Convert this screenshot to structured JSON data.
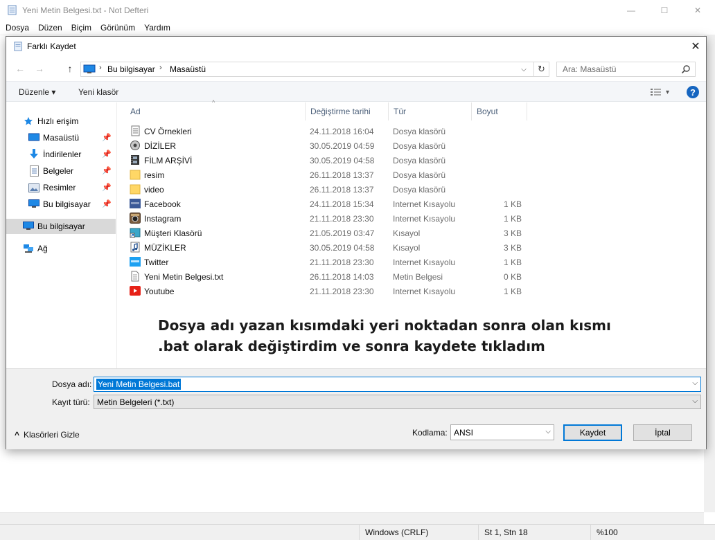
{
  "notepad": {
    "title": "Yeni Metin Belgesi.txt - Not Defteri",
    "menu": [
      "Dosya",
      "Düzen",
      "Biçim",
      "Görünüm",
      "Yardım"
    ],
    "status": {
      "line_ending": "Windows (CRLF)",
      "position": "St 1, Stn 18",
      "zoom": "%100"
    },
    "controls": {
      "minimize": "—",
      "maximize": "☐",
      "close": "✕"
    }
  },
  "dialog": {
    "title": "Farklı Kaydet",
    "close": "✕",
    "nav": {
      "back": "←",
      "forward": "→",
      "up": "↑"
    },
    "address": {
      "segments": [
        "Bu bilgisayar",
        "Masaüstü"
      ],
      "separator": "›",
      "dropdown": "⌵",
      "refresh": "↻"
    },
    "search": {
      "placeholder": "Ara: Masaüstü"
    },
    "commands": {
      "organize": "Düzenle ▾",
      "new_folder": "Yeni klasör",
      "help": "?",
      "view": "▾"
    },
    "sidebar": {
      "items": [
        {
          "label": "Hızlı erişim",
          "icon": "star-icon",
          "pinned": false
        },
        {
          "label": "Masaüstü",
          "icon": "desktop-icon",
          "pinned": true
        },
        {
          "label": "İndirilenler",
          "icon": "download-icon",
          "pinned": true
        },
        {
          "label": "Belgeler",
          "icon": "documents-icon",
          "pinned": true
        },
        {
          "label": "Resimler",
          "icon": "pictures-icon",
          "pinned": true
        },
        {
          "label": "Bu bilgisayar",
          "icon": "computer-icon",
          "pinned": true
        },
        {
          "label": "Bu bilgisayar",
          "icon": "computer-icon",
          "pinned": false,
          "selected": true
        },
        {
          "label": "Ağ",
          "icon": "network-icon",
          "pinned": false
        }
      ],
      "pin_glyph": "📌"
    },
    "columns": [
      "Ad",
      "Değiştirme tarihi",
      "Tür",
      "Boyut"
    ],
    "sort_glyph": "^",
    "files": [
      {
        "name": "CV Örnekleri",
        "date": "24.11.2018 16:04",
        "type": "Dosya klasörü",
        "size": "",
        "icon": "folder-docs-icon"
      },
      {
        "name": "DİZİLER",
        "date": "30.05.2019 04:59",
        "type": "Dosya klasörü",
        "size": "",
        "icon": "folder-media-icon"
      },
      {
        "name": "FİLM ARŞİVİ",
        "date": "30.05.2019 04:58",
        "type": "Dosya klasörü",
        "size": "",
        "icon": "folder-film-icon"
      },
      {
        "name": "resim",
        "date": "26.11.2018 13:37",
        "type": "Dosya klasörü",
        "size": "",
        "icon": "folder-icon"
      },
      {
        "name": "video",
        "date": "26.11.2018 13:37",
        "type": "Dosya klasörü",
        "size": "",
        "icon": "folder-icon"
      },
      {
        "name": "Facebook",
        "date": "24.11.2018 15:34",
        "type": "Internet Kısayolu",
        "size": "1 KB",
        "icon": "facebook-icon"
      },
      {
        "name": "Instagram",
        "date": "21.11.2018 23:30",
        "type": "Internet Kısayolu",
        "size": "1 KB",
        "icon": "instagram-icon"
      },
      {
        "name": "Müşteri Klasörü",
        "date": "21.05.2019 03:47",
        "type": "Kısayol",
        "size": "3 KB",
        "icon": "shortcut-icon"
      },
      {
        "name": "MÜZİKLER",
        "date": "30.05.2019 04:58",
        "type": "Kısayol",
        "size": "3 KB",
        "icon": "music-icon"
      },
      {
        "name": "Twitter",
        "date": "21.11.2018 23:30",
        "type": "Internet Kısayolu",
        "size": "1 KB",
        "icon": "twitter-icon"
      },
      {
        "name": "Yeni Metin Belgesi.txt",
        "date": "26.11.2018 14:03",
        "type": "Metin Belgesi",
        "size": "0 KB",
        "icon": "text-file-icon"
      },
      {
        "name": "Youtube",
        "date": "21.11.2018 23:30",
        "type": "Internet Kısayolu",
        "size": "1 KB",
        "icon": "youtube-icon"
      }
    ],
    "annotation": "Dosya adı yazan kısımdaki yeri noktadan sonra olan kısmı .bat olarak değiştirdim ve sonra kaydete tıkladım",
    "form": {
      "filename_label": "Dosya adı:",
      "filename_value": "Yeni Metin Belgesi.bat",
      "filetype_label": "Kayıt türü:",
      "filetype_value": "Metin Belgeleri (*.txt)",
      "encoding_label": "Kodlama:",
      "encoding_value": "ANSI",
      "save": "Kaydet",
      "cancel": "İptal",
      "hide_folders": "Klasörleri Gizle",
      "hide_glyph": "^",
      "dropdown_glyph": "⌵"
    },
    "colors": {
      "accent": "#0078d7",
      "help": "#1565c0",
      "facebook": "#3b5998",
      "youtube": "#e62117",
      "twitter": "#1da1f2",
      "folder": "#ffd766"
    }
  }
}
